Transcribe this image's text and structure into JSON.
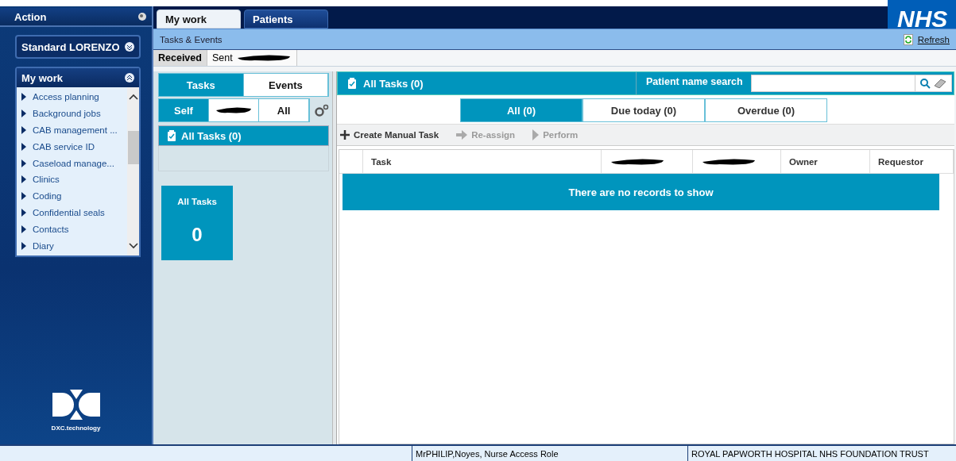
{
  "action_panel": {
    "title": "Action"
  },
  "profile": {
    "label": "Standard LORENZO"
  },
  "my_work_menu": {
    "title": "My work",
    "expanded": true,
    "items": [
      {
        "label": "Access planning"
      },
      {
        "label": "Background jobs"
      },
      {
        "label": "CAB management ..."
      },
      {
        "label": "CAB service ID"
      },
      {
        "label": "Caseload manage..."
      },
      {
        "label": "Clinics"
      },
      {
        "label": "Coding"
      },
      {
        "label": "Confidential seals"
      },
      {
        "label": "Contacts"
      },
      {
        "label": "Diary"
      }
    ]
  },
  "logo": {
    "caption": "DXC.technology"
  },
  "tabs": [
    {
      "label": "My work",
      "selected": true
    },
    {
      "label": "Patients",
      "selected": false
    }
  ],
  "nhs_logo": "NHS",
  "section": {
    "title": "Tasks & Events",
    "refresh": "Refresh"
  },
  "sub_tabs": [
    {
      "label": "Received",
      "selected": true,
      "redacted_suffix": false
    },
    {
      "label": "Sent",
      "selected": false,
      "redacted_suffix": true
    }
  ],
  "view_toggle": [
    {
      "label": "Tasks",
      "selected": true
    },
    {
      "label": "Events",
      "selected": false
    }
  ],
  "scope_toggle": [
    {
      "kind": "text",
      "label": "Self",
      "selected": true
    },
    {
      "kind": "redacted",
      "selected": false
    },
    {
      "kind": "text",
      "label": "All",
      "selected": false
    }
  ],
  "task_groups": [
    {
      "label": "All Tasks (0)",
      "selected": true
    }
  ],
  "tiles": [
    {
      "label": "All Tasks",
      "count": "0"
    }
  ],
  "list_header": {
    "title": "All Tasks (0)",
    "search_label": "Patient name search"
  },
  "filters": [
    {
      "label": "All (0)",
      "selected": true
    },
    {
      "label": "Due today (0)",
      "selected": false
    },
    {
      "label": "Overdue (0)",
      "selected": false
    }
  ],
  "toolbar": [
    {
      "kind": "plus",
      "label": "Create Manual Task",
      "disabled": false
    },
    {
      "kind": "arrow",
      "label": "Re-assign",
      "disabled": true
    },
    {
      "kind": "play",
      "label": "Perform",
      "disabled": true
    }
  ],
  "table": {
    "columns": [
      {
        "kind": "text",
        "label": "Task"
      },
      {
        "kind": "redacted"
      },
      {
        "kind": "redacted"
      },
      {
        "kind": "text",
        "label": "Owner"
      },
      {
        "kind": "text",
        "label": "Requestor"
      }
    ],
    "empty_message": "There are no records to show"
  },
  "status_bar": [
    "MrPHILIP,Noyes, Nurse Access Role",
    "ROYAL PAPWORTH HOSPITAL NHS FOUNDATION TRUST"
  ]
}
